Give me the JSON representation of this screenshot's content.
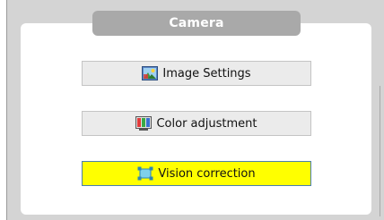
{
  "header": {
    "title": "Camera"
  },
  "buttons": {
    "image_settings": {
      "label": "Image Settings",
      "icon": "image-settings-icon"
    },
    "color_adjustment": {
      "label": "Color adjustment",
      "icon": "color-adjustment-icon"
    },
    "vision_correction": {
      "label": "Vision correction",
      "icon": "vision-correction-icon",
      "selected": true
    }
  },
  "colors": {
    "background": "#d4d4d4",
    "panel": "#ffffff",
    "header": "#a9a9a9",
    "button": "#ebebeb",
    "selected": "#ffff00",
    "selected_border": "#4a7fb0"
  }
}
